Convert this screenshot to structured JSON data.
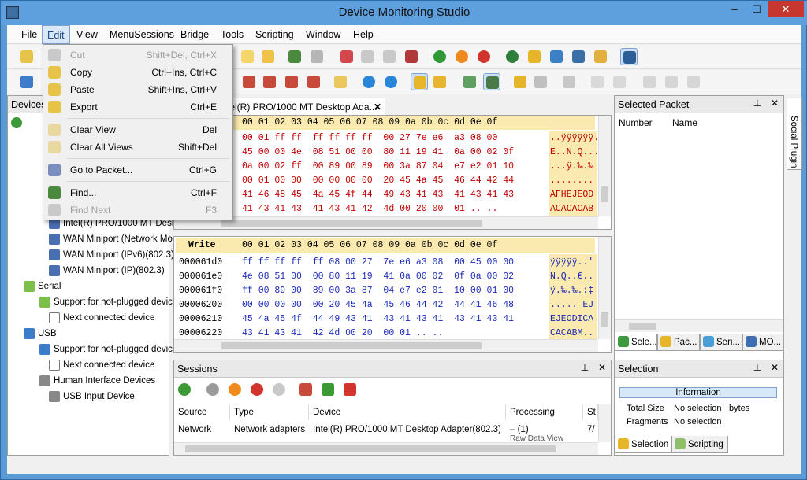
{
  "window": {
    "title": "Device Monitoring Studio",
    "minimize": "‒",
    "maximize": "☐",
    "close": "✕"
  },
  "menu": [
    "File",
    "Edit",
    "View",
    "MenuSessions",
    "Bridge",
    "Tools",
    "Scripting",
    "Window",
    "Help"
  ],
  "edit_menu": [
    {
      "label": "Cut",
      "shortcut": "Shift+Del, Ctrl+X",
      "disabled": true,
      "icon": "scissors-icon"
    },
    {
      "label": "Copy",
      "shortcut": "Ctrl+Ins, Ctrl+C",
      "disabled": false,
      "icon": "copy-icon"
    },
    {
      "label": "Paste",
      "shortcut": "Shift+Ins, Ctrl+V",
      "disabled": false,
      "icon": "paste-icon"
    },
    {
      "label": "Export",
      "shortcut": "Ctrl+E",
      "disabled": false,
      "icon": "export-icon"
    },
    {
      "label": "Clear View",
      "shortcut": "Del",
      "disabled": false,
      "icon": "clear-view-icon"
    },
    {
      "label": "Clear All Views",
      "shortcut": "Shift+Del",
      "disabled": false,
      "icon": "clear-all-icon"
    },
    {
      "label": "Go to Packet...",
      "shortcut": "Ctrl+G",
      "disabled": false,
      "icon": "goto-packet-icon"
    },
    {
      "label": "Find...",
      "shortcut": "Ctrl+F",
      "disabled": false,
      "icon": "find-icon"
    },
    {
      "label": "Find Next",
      "shortcut": "F3",
      "disabled": true,
      "icon": "find-next-icon"
    }
  ],
  "devices": {
    "title": "Devices",
    "pin": "📌",
    "close": "✕",
    "tree": [
      {
        "label": "Intel(R) PRO/1000 MT Desk",
        "icon": "network-adapter-icon"
      },
      {
        "label": "WAN Miniport (Network Mor",
        "icon": "network-adapter-icon"
      },
      {
        "label": "WAN Miniport (IPv6)(802.3)",
        "icon": "network-adapter-icon"
      },
      {
        "label": "WAN Miniport (IP)(802.3)",
        "icon": "network-adapter-icon"
      },
      {
        "label": "Serial",
        "icon": "serial-icon"
      },
      {
        "label": "Support for hot-plugged devic",
        "icon": "usb-device-icon"
      },
      {
        "label": "Next connected device",
        "icon": "device-icon"
      },
      {
        "label": "USB",
        "icon": "usb-icon"
      },
      {
        "label": "Support for hot-plugged devic",
        "icon": "usb-device-icon"
      },
      {
        "label": "Next connected device",
        "icon": "device-icon"
      },
      {
        "label": "Human Interface Devices",
        "icon": "hid-icon"
      },
      {
        "label": "USB Input Device",
        "icon": "hid-device-icon"
      }
    ]
  },
  "doc_tab": {
    "label": "Intel(R) PRO/1000 MT Desktop Ada...",
    "close": "✕"
  },
  "hex_top": {
    "header": "00 01 02 03  04 05 06 07  08 09 0a 0b  0c 0d 0e 0f",
    "rows": [
      {
        "bytes": "00 01 ff ff  ff ff ff ff  00 27 7e e6  a3 08 00",
        "ascii": "..ÿÿÿÿÿÿ.'"
      },
      {
        "bytes": "45 00 00 4e  08 51 00 00  80 11 19 41  0a 00 02 0f",
        "ascii": "E..N.Q..."
      },
      {
        "bytes": "0a 00 02 ff  00 89 00 89  00 3a 87 04  e7 e2 01 10",
        "ascii": "...ÿ.‰.‰"
      },
      {
        "bytes": "00 01 00 00  00 00 00 00  20 45 4a 45  46 44 42 44",
        "ascii": "........"
      },
      {
        "bytes": "41 46 48 45  4a 45 4f 44  49 43 41 43  41 43 41 43",
        "ascii": "AFHEJEOD"
      },
      {
        "bytes": "41 43 41 43  41 43 41 42  4d 00 20 00  01 .. ..",
        "ascii": "ACACACAB"
      }
    ]
  },
  "hex_write": {
    "label": "Write",
    "header": "00 01 02 03  04 05 06 07  08 09 0a 0b  0c 0d 0e 0f",
    "rows": [
      {
        "offset": "000061d0",
        "bytes": "ff ff ff ff  ff 08 00 27  7e e6 a3 08  00 45 00 00",
        "ascii": "ÿÿÿÿÿ..'"
      },
      {
        "offset": "000061e0",
        "bytes": "4e 08 51 00  00 80 11 19  41 0a 00 02  0f 0a 00 02",
        "ascii": "N.Q..€.."
      },
      {
        "offset": "000061f0",
        "bytes": "ff 00 89 00  89 00 3a 87  04 e7 e2 01  10 00 01 00",
        "ascii": "ÿ.‰.‰.:‡"
      },
      {
        "offset": "00006200",
        "bytes": "00 00 00 00  00 20 45 4a  45 46 44 42  44 41 46 48",
        "ascii": "..... EJ"
      },
      {
        "offset": "00006210",
        "bytes": "45 4a 45 4f  44 49 43 41  43 41 43 41  43 41 43 41",
        "ascii": "EJEODICA"
      },
      {
        "offset": "00006220",
        "bytes": "43 41 43 41  42 4d 00 20  00 01 .. ..",
        "ascii": "CACABM.."
      }
    ]
  },
  "selected_packet": {
    "title": "Selected Packet",
    "columns": [
      "Number",
      "Name"
    ],
    "tabs": [
      "Sele...",
      "Pac...",
      "Seri...",
      "MO..."
    ]
  },
  "social_plugin": "Social Plugin",
  "sessions": {
    "title": "Sessions",
    "columns": [
      "Source",
      "Type",
      "Device",
      "Processing",
      "St"
    ],
    "rows": [
      {
        "source": "Network",
        "type": "Network adapters",
        "device": "Intel(R) PRO/1000 MT Desktop Adapter(802.3)",
        "processing": "– (1)",
        "status": "7/"
      }
    ],
    "extra": "Raw Data View"
  },
  "selection": {
    "title": "Selection",
    "info_header": "Information",
    "rows": [
      {
        "k": "Total Size",
        "v": "No selection",
        "u": "bytes"
      },
      {
        "k": "Fragments",
        "v": "No selection",
        "u": ""
      }
    ],
    "tabs": [
      "Selection",
      "Scripting"
    ]
  }
}
